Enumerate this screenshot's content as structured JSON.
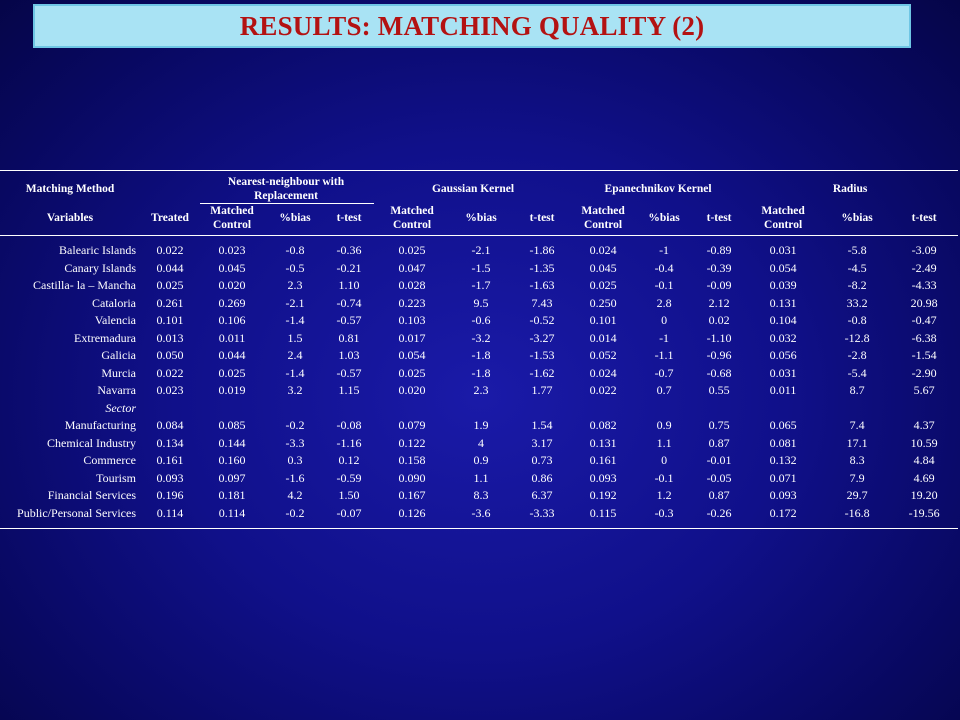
{
  "title": "RESULTS: MATCHING QUALITY (2)",
  "header": {
    "method_label": "Matching Method",
    "variables_label": "Variables",
    "treated_label": "Treated",
    "methods": [
      {
        "line1": "Nearest-neighbour with",
        "line2": "Replacement"
      },
      {
        "line1": "Gaussian Kernel",
        "line2": ""
      },
      {
        "line1": "Epanechnikov Kernel",
        "line2": ""
      },
      {
        "line1": "Radius",
        "line2": ""
      }
    ],
    "matched_control_line1": "Matched",
    "matched_control_line2": "Control",
    "bias_label": "%bias",
    "ttest_label": "t-test"
  },
  "rows": [
    {
      "name": "Balearic Islands",
      "cells": [
        "0.022",
        "0.023",
        "-0.8",
        "-0.36",
        "0.025",
        "-2.1",
        "-1.86",
        "0.024",
        "-1",
        "-0.89",
        "0.031",
        "-5.8",
        "-3.09"
      ]
    },
    {
      "name": "Canary Islands",
      "cells": [
        "0.044",
        "0.045",
        "-0.5",
        "-0.21",
        "0.047",
        "-1.5",
        "-1.35",
        "0.045",
        "-0.4",
        "-0.39",
        "0.054",
        "-4.5",
        "-2.49"
      ]
    },
    {
      "name": "Castilla- la – Mancha",
      "cells": [
        "0.025",
        "0.020",
        "2.3",
        "1.10",
        "0.028",
        "-1.7",
        "-1.63",
        "0.025",
        "-0.1",
        "-0.09",
        "0.039",
        "-8.2",
        "-4.33"
      ]
    },
    {
      "name": "Cataloria",
      "cells": [
        "0.261",
        "0.269",
        "-2.1",
        "-0.74",
        "0.223",
        "9.5",
        "7.43",
        "0.250",
        "2.8",
        "2.12",
        "0.131",
        "33.2",
        "20.98"
      ]
    },
    {
      "name": "Valencia",
      "cells": [
        "0.101",
        "0.106",
        "-1.4",
        "-0.57",
        "0.103",
        "-0.6",
        "-0.52",
        "0.101",
        "0",
        "0.02",
        "0.104",
        "-0.8",
        "-0.47"
      ]
    },
    {
      "name": "Extremadura",
      "cells": [
        "0.013",
        "0.011",
        "1.5",
        "0.81",
        "0.017",
        "-3.2",
        "-3.27",
        "0.014",
        "-1",
        "-1.10",
        "0.032",
        "-12.8",
        "-6.38"
      ]
    },
    {
      "name": "Galicia",
      "cells": [
        "0.050",
        "0.044",
        "2.4",
        "1.03",
        "0.054",
        "-1.8",
        "-1.53",
        "0.052",
        "-1.1",
        "-0.96",
        "0.056",
        "-2.8",
        "-1.54"
      ]
    },
    {
      "name": "Murcia",
      "cells": [
        "0.022",
        "0.025",
        "-1.4",
        "-0.57",
        "0.025",
        "-1.8",
        "-1.62",
        "0.024",
        "-0.7",
        "-0.68",
        "0.031",
        "-5.4",
        "-2.90"
      ]
    },
    {
      "name": "Navarra",
      "cells": [
        "0.023",
        "0.019",
        "3.2",
        "1.15",
        "0.020",
        "2.3",
        "1.77",
        "0.022",
        "0.7",
        "0.55",
        "0.011",
        "8.7",
        "5.67"
      ]
    },
    {
      "name": "Sector",
      "section": true,
      "cells": [
        "",
        "",
        "",
        "",
        "",
        "",
        "",
        "",
        "",
        "",
        "",
        "",
        ""
      ]
    },
    {
      "name": "Manufacturing",
      "cells": [
        "0.084",
        "0.085",
        "-0.2",
        "-0.08",
        "0.079",
        "1.9",
        "1.54",
        "0.082",
        "0.9",
        "0.75",
        "0.065",
        "7.4",
        "4.37"
      ]
    },
    {
      "name": "Chemical Industry",
      "cells": [
        "0.134",
        "0.144",
        "-3.3",
        "-1.16",
        "0.122",
        "4",
        "3.17",
        "0.131",
        "1.1",
        "0.87",
        "0.081",
        "17.1",
        "10.59"
      ]
    },
    {
      "name": "Commerce",
      "cells": [
        "0.161",
        "0.160",
        "0.3",
        "0.12",
        "0.158",
        "0.9",
        "0.73",
        "0.161",
        "0",
        "-0.01",
        "0.132",
        "8.3",
        "4.84"
      ]
    },
    {
      "name": "Tourism",
      "cells": [
        "0.093",
        "0.097",
        "-1.6",
        "-0.59",
        "0.090",
        "1.1",
        "0.86",
        "0.093",
        "-0.1",
        "-0.05",
        "0.071",
        "7.9",
        "4.69"
      ]
    },
    {
      "name": "Financial Services",
      "cells": [
        "0.196",
        "0.181",
        "4.2",
        "1.50",
        "0.167",
        "8.3",
        "6.37",
        "0.192",
        "1.2",
        "0.87",
        "0.093",
        "29.7",
        "19.20"
      ]
    },
    {
      "name": "Public/Personal Services",
      "cells": [
        "0.114",
        "0.114",
        "-0.2",
        "-0.07",
        "0.126",
        "-3.6",
        "-3.33",
        "0.115",
        "-0.3",
        "-0.26",
        "0.172",
        "-16.8",
        "-19.56"
      ]
    }
  ]
}
